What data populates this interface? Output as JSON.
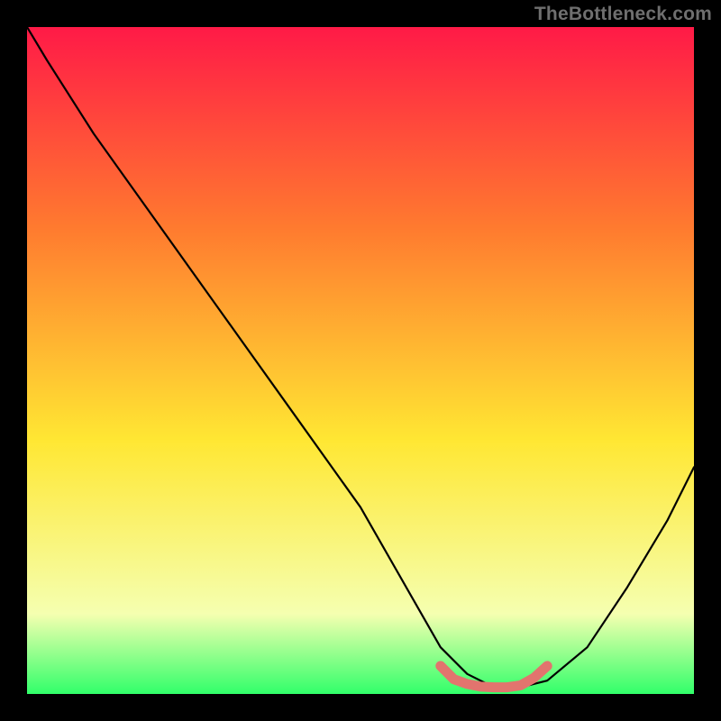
{
  "watermark": "TheBottleneck.com",
  "colors": {
    "gradient_top": "#ff1a47",
    "gradient_upper_mid": "#ff7a2f",
    "gradient_mid": "#ffe733",
    "gradient_lower_mid": "#f5ffb0",
    "gradient_bottom": "#31ff6a",
    "curve": "#000000",
    "highlight": "#e2746e"
  },
  "chart_data": {
    "type": "line",
    "title": "",
    "xlabel": "",
    "ylabel": "",
    "xlim": [
      0,
      100
    ],
    "ylim": [
      0,
      100
    ],
    "series": [
      {
        "name": "bottleneck-curve",
        "x": [
          0,
          3,
          10,
          20,
          30,
          40,
          50,
          58,
          62,
          66,
          70,
          74,
          78,
          84,
          90,
          96,
          100
        ],
        "values": [
          100,
          95,
          84,
          70,
          56,
          42,
          28,
          14,
          7,
          3,
          1,
          1,
          2,
          7,
          16,
          26,
          34
        ]
      }
    ],
    "highlight_segment": {
      "x": [
        62,
        64,
        66,
        68,
        70,
        72,
        74,
        76,
        78
      ],
      "values": [
        4.2,
        2.2,
        1.5,
        1.1,
        1.0,
        1.0,
        1.3,
        2.4,
        4.2
      ]
    }
  }
}
